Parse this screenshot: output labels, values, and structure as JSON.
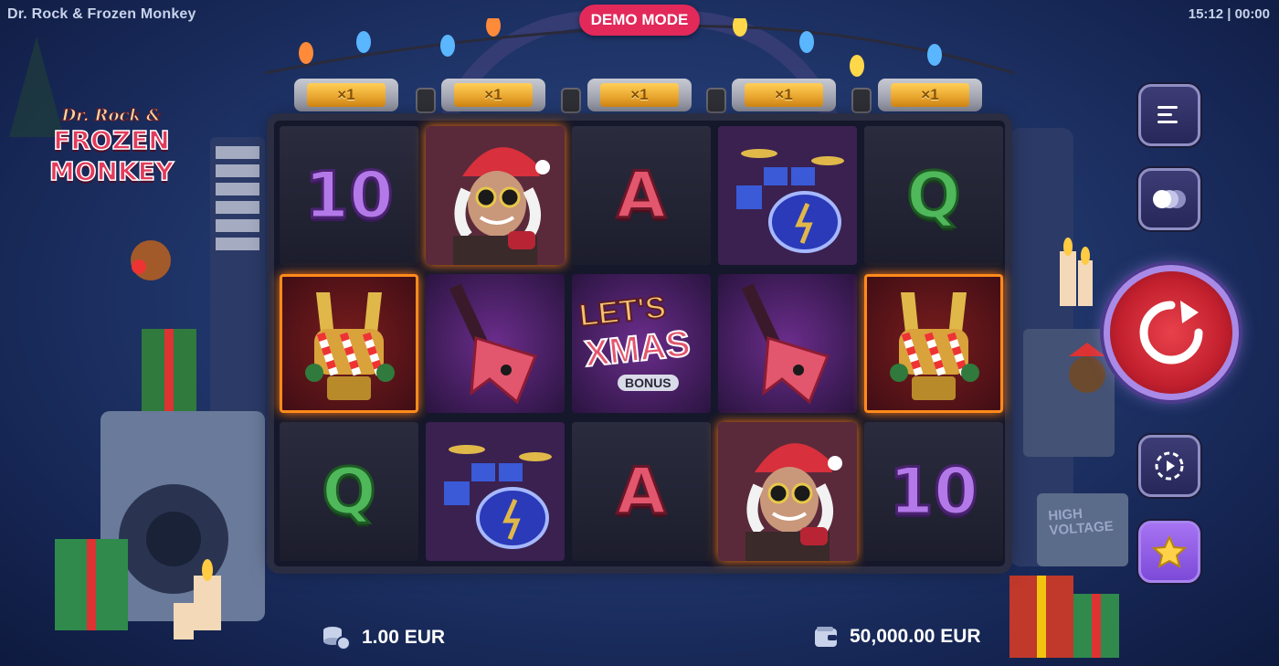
{
  "window": {
    "title": "Dr. Rock & Frozen Monkey",
    "clock": "15:12 | 00:00"
  },
  "badge": {
    "demo_label": "DEMO MODE"
  },
  "logo": {
    "line1": "Dr. Rock &",
    "line2": "FROZEN",
    "line3": "MONKEY"
  },
  "multipliers": [
    "×1",
    "×1",
    "×1",
    "×1",
    "×1"
  ],
  "reels": {
    "grid": [
      [
        "10",
        "dr-rock",
        "A",
        "drums",
        "Q"
      ],
      [
        "rock-hand",
        "guitar",
        "xmas-bonus",
        "guitar",
        "rock-hand"
      ],
      [
        "Q",
        "drums",
        "A",
        "dr-rock",
        "10"
      ]
    ],
    "bonus_text": {
      "line1": "LET'S",
      "line2": "XMAS",
      "line3": "BONUS"
    }
  },
  "controls": {
    "menu_icon": "menu-icon",
    "autoplay_icon": "speed-toggle-icon",
    "spin_icon": "spin-arrow-icon",
    "autospin_icon": "autospin-icon",
    "favorites_icon": "star-icon"
  },
  "bottom": {
    "bet_value": "1.00 EUR",
    "balance_value": "50,000.00 EUR"
  },
  "decor": {
    "amp_label_line1": "HIGH",
    "amp_label_line2": "VOLTAGE"
  },
  "colors": {
    "accent": "#e2295a",
    "spin": "#c3202e",
    "frame_glow": "#ff8a1c"
  }
}
